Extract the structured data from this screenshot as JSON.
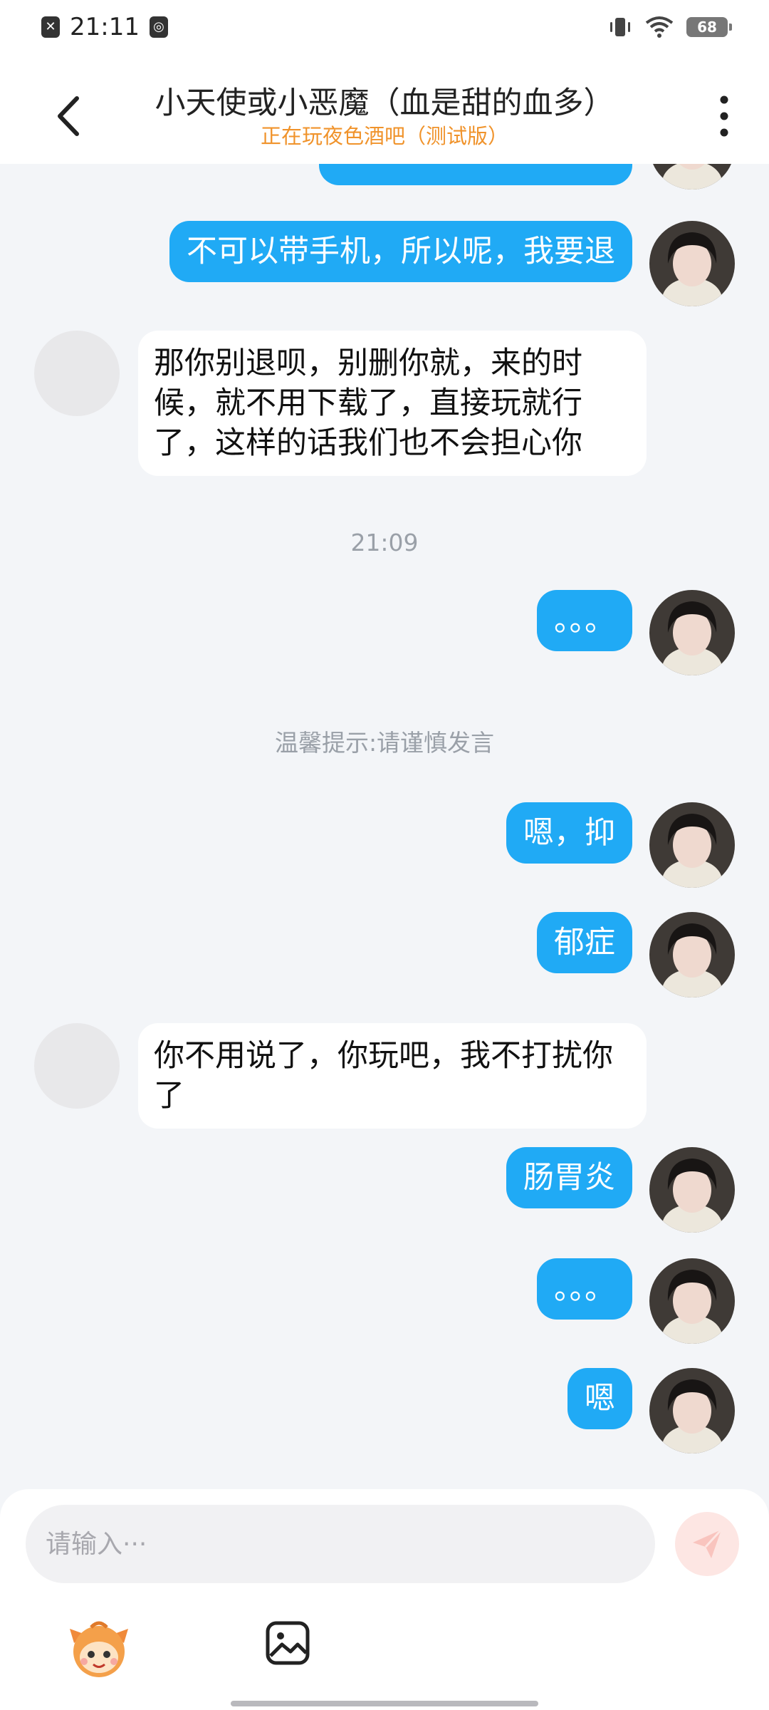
{
  "status_bar": {
    "time": "21:11",
    "battery": "68"
  },
  "header": {
    "title": "小天使或小恶魔（血是甜的血多）",
    "subtitle": "正在玩夜色酒吧（测试版）"
  },
  "messages": {
    "m1": "不可以带手机，所以呢，我要退",
    "m2": "那你别退呗，别删你就，来的时候，就不用下载了，直接玩就行了，这样的话我们也不会担心你",
    "time": "21:09",
    "m3": "。。。",
    "notice": "温馨提示:请谨慎发言",
    "m4": "嗯，抑",
    "m5": "郁症",
    "m6": "你不用说了，你玩吧，我不打扰你了",
    "m7": "肠胃炎",
    "m8": "。。。",
    "m9": "嗯"
  },
  "input": {
    "placeholder": "请输入···"
  },
  "colors": {
    "accent_blue": "#20aaf5",
    "subtitle_orange": "#f0932b",
    "send_disabled": "#fde6e3"
  },
  "icons": {
    "back": "chevron-left-icon",
    "more": "more-vertical-icon",
    "send": "send-icon",
    "emoji": "emoji-mascot-icon",
    "image": "image-icon"
  }
}
